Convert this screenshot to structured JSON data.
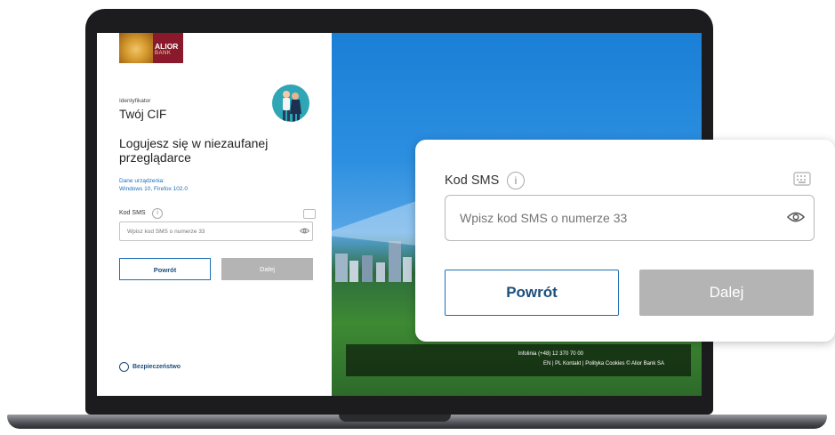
{
  "brand": {
    "name": "ALIOR",
    "sub": "BANK"
  },
  "login": {
    "identifier_label": "Identyfikator",
    "identifier_value": "Twój CIF",
    "heading": "Logujesz się w niezaufanej przeglądarce",
    "device_label": "Dane urządzenia:",
    "device_value": "Windows 10, Firefox 102.0",
    "sms_label": "Kod SMS",
    "sms_placeholder": "Wpisz kod SMS o numerze 33",
    "back_label": "Powrót",
    "next_label": "Dalej",
    "security_label": "Bezpieczeństwo"
  },
  "footer": {
    "infoline": "Infolinia (+48) 12 370 70 00",
    "links": "EN | PL     Kontakt |  Polityka Cookies     © Alior Bank SA"
  },
  "zoom": {
    "sms_label": "Kod SMS",
    "info_glyph": "i",
    "sms_placeholder": "Wpisz kod SMS o numerze 33",
    "back_label": "Powrót",
    "next_label": "Dalej"
  },
  "icons": {
    "info": "info-icon",
    "keyboard": "keyboard-icon",
    "eye": "eye-icon",
    "shield": "shield-icon"
  },
  "colors": {
    "brand": "#8a1a2b",
    "accent": "#1d6fb8",
    "disabled": "#b4b4b4"
  }
}
